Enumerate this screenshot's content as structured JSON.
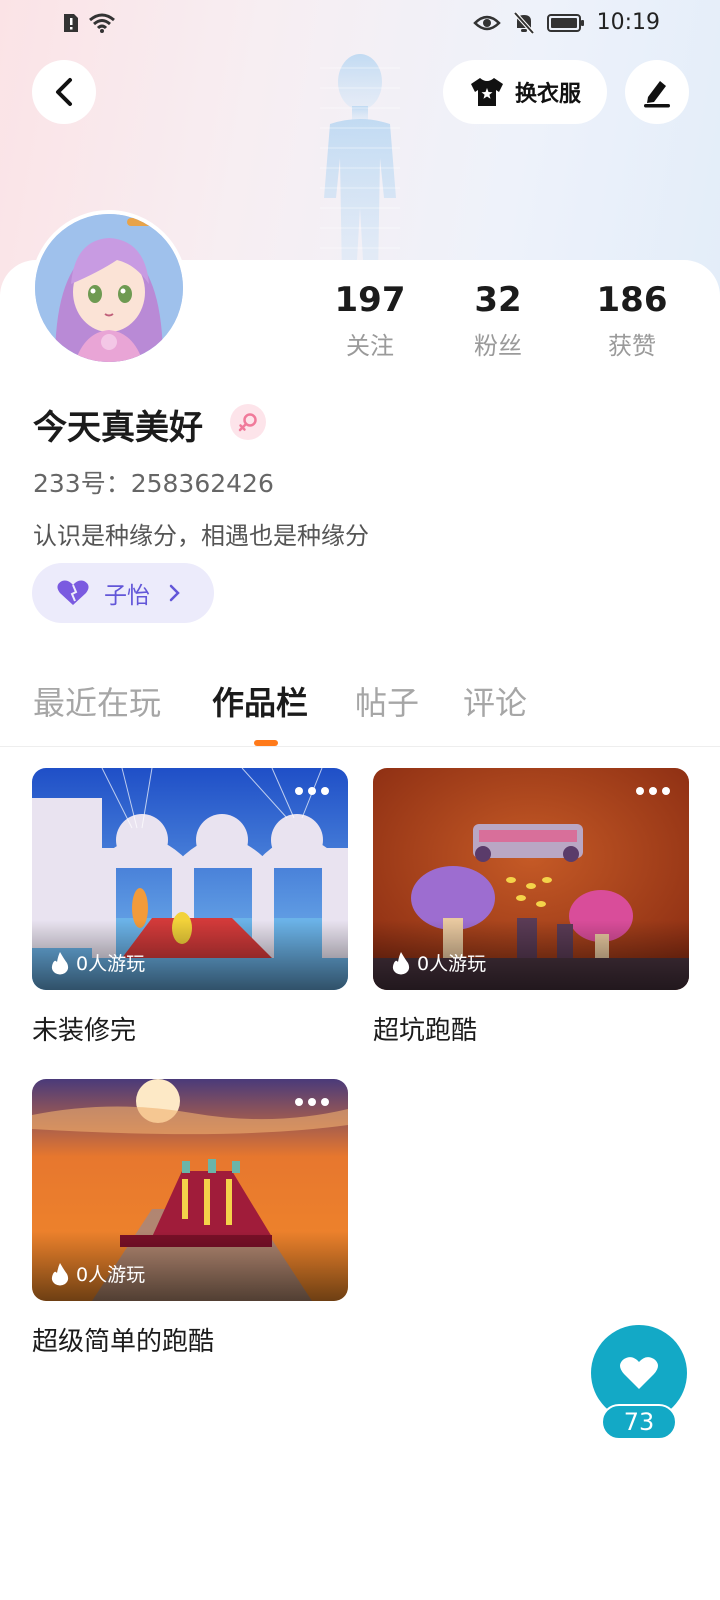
{
  "status_bar": {
    "time": "10:19"
  },
  "header": {
    "dress_up_label": "换衣服"
  },
  "profile": {
    "nickname": "今天真美好",
    "uid": "233号：258362426",
    "bio": "认识是种缘分，相遇也是种缘分",
    "relation_name": "子怡"
  },
  "stats": [
    {
      "value": "197",
      "label": "关注"
    },
    {
      "value": "32",
      "label": "粉丝"
    },
    {
      "value": "186",
      "label": "获赞"
    }
  ],
  "tabs": [
    {
      "label": "最近在玩",
      "active": false
    },
    {
      "label": "作品栏",
      "active": true
    },
    {
      "label": "帖子",
      "active": false
    },
    {
      "label": "评论",
      "active": false
    }
  ],
  "works": [
    {
      "title": "未装修完",
      "plays": "0人游玩"
    },
    {
      "title": "超坑跑酷",
      "plays": "0人游玩"
    },
    {
      "title": "超级简单的跑酷",
      "plays": "0人游玩"
    }
  ],
  "like_count": "73",
  "colors": {
    "accent_orange": "#ff7a1a",
    "like_fab": "#13a9c6",
    "chip_bg": "#ecebfb",
    "chip_text": "#6256d8"
  }
}
